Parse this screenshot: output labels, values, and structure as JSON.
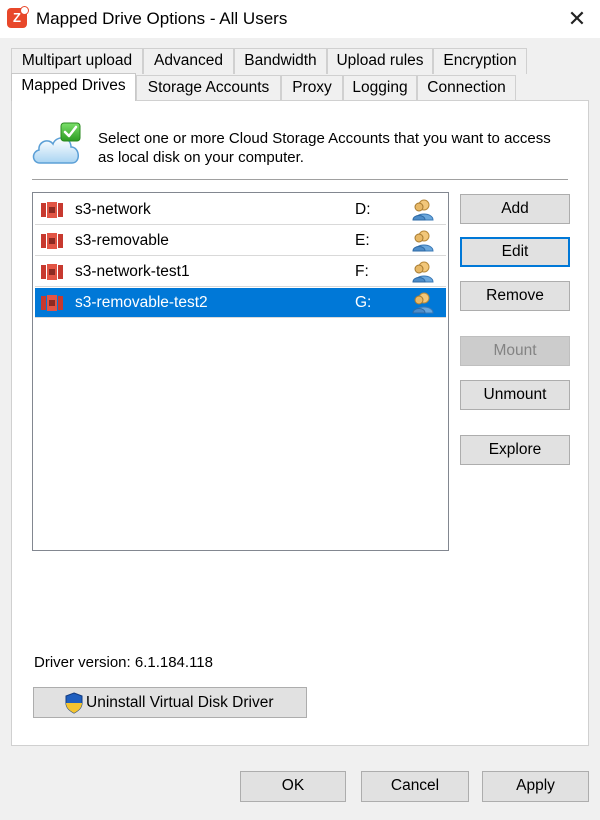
{
  "window": {
    "title": "Mapped Drive Options - All Users",
    "app_icon_letter": "Z",
    "close_glyph": "✕"
  },
  "tabs_row1": [
    "Multipart upload",
    "Advanced",
    "Bandwidth",
    "Upload rules",
    "Encryption"
  ],
  "tabs_row2": [
    "Mapped Drives",
    "Storage Accounts",
    "Proxy",
    "Logging",
    "Connection"
  ],
  "active_tab": "Mapped Drives",
  "intro": {
    "text": "Select one or more Cloud Storage Accounts that you want to access as local disk on your computer.",
    "icon": "cloud-check-icon"
  },
  "drives": [
    {
      "name": "s3-network",
      "letter": "D:",
      "selected": false
    },
    {
      "name": "s3-removable",
      "letter": "E:",
      "selected": false
    },
    {
      "name": "s3-network-test1",
      "letter": "F:",
      "selected": false
    },
    {
      "name": "s3-removable-test2",
      "letter": "G:",
      "selected": true
    }
  ],
  "buttons": {
    "add": "Add",
    "edit": "Edit",
    "remove": "Remove",
    "mount": "Mount",
    "unmount": "Unmount",
    "explore": "Explore"
  },
  "driver": {
    "version_label": "Driver version: 6.1.184.118",
    "uninstall": "Uninstall Virtual Disk Driver"
  },
  "footer": {
    "ok": "OK",
    "cancel": "Cancel",
    "apply": "Apply"
  },
  "colors": {
    "selection": "#0078d7",
    "s3_icon": "#c7392f"
  }
}
